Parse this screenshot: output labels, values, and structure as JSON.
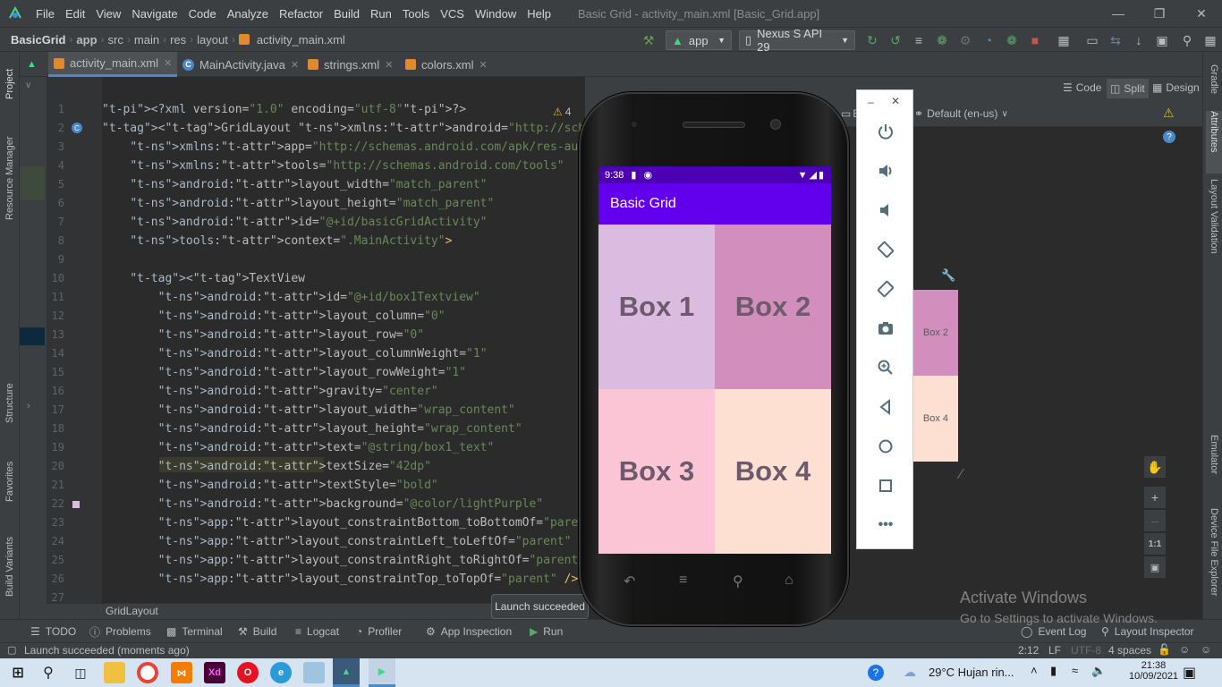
{
  "menubar": {
    "items": [
      "File",
      "Edit",
      "View",
      "Navigate",
      "Code",
      "Analyze",
      "Refactor",
      "Build",
      "Run",
      "Tools",
      "VCS",
      "Window",
      "Help"
    ],
    "window_title": "Basic Grid - activity_main.xml [Basic_Grid.app]"
  },
  "navbar": {
    "crumbs": [
      "BasicGrid",
      "app",
      "src",
      "main",
      "res",
      "layout",
      "activity_main.xml"
    ],
    "run_config": "app",
    "device": "Nexus S API 29"
  },
  "tabs": [
    {
      "label": "activity_main.xml",
      "active": true
    },
    {
      "label": "MainActivity.java",
      "active": false
    },
    {
      "label": "strings.xml",
      "active": false
    },
    {
      "label": "colors.xml",
      "active": false
    }
  ],
  "left_tabs": [
    "Project",
    "Resource Manager",
    "Structure",
    "Favorites",
    "Build Variants"
  ],
  "right_tabs": [
    "Gradle",
    "Attributes",
    "Layout Validation",
    "Emulator",
    "Device File Explorer"
  ],
  "view_modes": [
    "Code",
    "Split",
    "Design"
  ],
  "warnings_count": "4",
  "design": {
    "locale": "Default (en-us)",
    "truncated_label": "Ba",
    "preview_boxes": [
      "Box 2",
      "Box 4"
    ]
  },
  "code_lines": [
    {
      "n": "1",
      "text": "<?xml version=\"1.0\" encoding=\"utf-8\"?>"
    },
    {
      "n": "2",
      "text": "<GridLayout xmlns:android=\"http://schemas.android.com/apk/res/android\""
    },
    {
      "n": "3",
      "text": "    xmlns:app=\"http://schemas.android.com/apk/res-auto\""
    },
    {
      "n": "4",
      "text": "    xmlns:tools=\"http://schemas.android.com/tools\""
    },
    {
      "n": "5",
      "text": "    android:layout_width=\"match_parent\""
    },
    {
      "n": "6",
      "text": "    android:layout_height=\"match_parent\""
    },
    {
      "n": "7",
      "text": "    android:id=\"@+id/basicGridActivity\""
    },
    {
      "n": "8",
      "text": "    tools:context=\".MainActivity\">"
    },
    {
      "n": "9",
      "text": ""
    },
    {
      "n": "10",
      "text": "    <TextView"
    },
    {
      "n": "11",
      "text": "        android:id=\"@+id/box1Textview\""
    },
    {
      "n": "12",
      "text": "        android:layout_column=\"0\""
    },
    {
      "n": "13",
      "text": "        android:layout_row=\"0\""
    },
    {
      "n": "14",
      "text": "        android:layout_columnWeight=\"1\""
    },
    {
      "n": "15",
      "text": "        android:layout_rowWeight=\"1\""
    },
    {
      "n": "16",
      "text": "        android:gravity=\"center\""
    },
    {
      "n": "17",
      "text": "        android:layout_width=\"wrap_content\""
    },
    {
      "n": "18",
      "text": "        android:layout_height=\"wrap_content\""
    },
    {
      "n": "19",
      "text": "        android:text=\"@string/box1_text\""
    },
    {
      "n": "20",
      "text": "        android:textSize=\"42dp\""
    },
    {
      "n": "21",
      "text": "        android:textStyle=\"bold\""
    },
    {
      "n": "22",
      "text": "        android:background=\"@color/lightPurple\""
    },
    {
      "n": "23",
      "text": "        app:layout_constraintBottom_toBottomOf=\"parent\""
    },
    {
      "n": "24",
      "text": "        app:layout_constraintLeft_toLeftOf=\"parent\""
    },
    {
      "n": "25",
      "text": "        app:layout_constraintRight_toRightOf=\"parent\""
    },
    {
      "n": "26",
      "text": "        app:layout_constraintTop_toTopOf=\"parent\" />"
    },
    {
      "n": "27",
      "text": ""
    }
  ],
  "editor_breadcrumb": "GridLayout",
  "phone": {
    "time": "9:38",
    "app_title": "Basic Grid",
    "boxes": [
      {
        "label": "Box 1",
        "color": "#dcbbe0"
      },
      {
        "label": "Box 2",
        "color": "#d28fbd"
      },
      {
        "label": "Box 3",
        "color": "#fcc5d5"
      },
      {
        "label": "Box 4",
        "color": "#fde0d2"
      }
    ]
  },
  "toast": "Launch succeeded",
  "tool_tabs": [
    "TODO",
    "Problems",
    "Terminal",
    "Build",
    "Logcat",
    "Profiler",
    "App Inspection",
    "Run",
    "Event Log",
    "Layout Inspector"
  ],
  "status": {
    "message": "Launch succeeded (moments ago)",
    "position": "2:12",
    "line_sep": "LF",
    "encoding": "UTF-8",
    "indent": "4 spaces"
  },
  "watermark": {
    "line1": "Activate Windows",
    "line2": "Go to Settings to activate Windows."
  },
  "taskbar": {
    "weather": "29°C  Hujan rin...",
    "time": "21:38",
    "date": "10/09/2021"
  },
  "colors": {
    "accent": "#4a88c7",
    "app_bar": "#6200ee",
    "status_bar": "#4d00b3"
  }
}
